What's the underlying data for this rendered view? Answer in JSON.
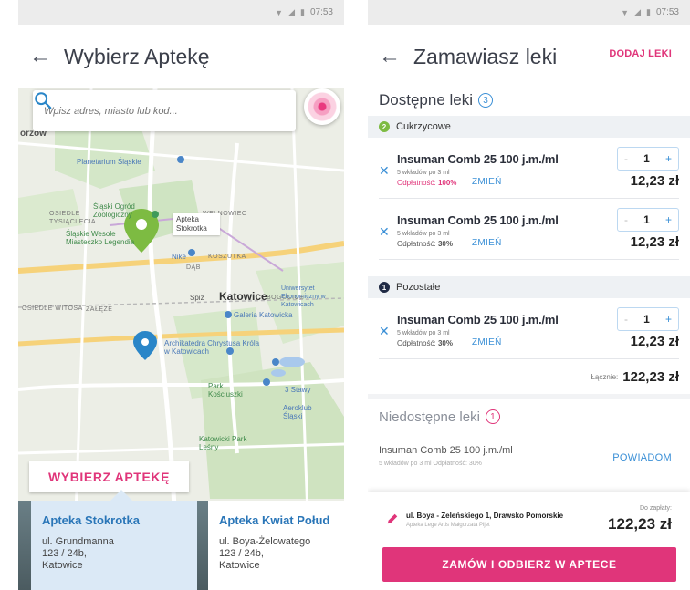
{
  "left": {
    "status": {
      "time": "07:53"
    },
    "title": "Wybierz Aptekę",
    "search": {
      "placeholder": "Wpisz adres, miasto lub kod..."
    },
    "map": {
      "labels": {
        "city": "Katowice",
        "chorzow": "orzów",
        "planetarium": "Planetarium Śląskie",
        "garden": "Śląski Ogród Zoologiczny",
        "osiedle_1000": "OSIEDLE TYSIĄCLECIA",
        "stadium": "Śląskie Wesołe Miasteczko Legendia",
        "welnowiec": "WELNOWIEC",
        "nike": "Nike",
        "koszutka": "KOSZUTKA",
        "dab": "DĄB",
        "bogucice": "BOGUCICE",
        "spiz": "Spiż",
        "witosa": "OSIEDLE WITOSA",
        "zaleze": "ZAŁĘŻE",
        "uni": "Uniwersytet Ekonomiczny w Katowicach",
        "galeria": "Galeria Katowicka",
        "archikatedra": "Archikatedra Chrystusa Króla w Katowicach",
        "park": "Park Kościuszki",
        "stawy": "3 Stawy",
        "aeroklub": "Aeroklub Śląski",
        "forest": "Katowicki Park Leśny"
      },
      "pin_label": "Apteka Stokrotka"
    },
    "choose_button": "WYBIERZ APTEKĘ",
    "cards": [
      {
        "name": "Apteka Stokrotka",
        "addr1": "ul. Grundmanna",
        "addr2": "123 / 24b,",
        "addr3": "Katowice"
      },
      {
        "name": "Apteka Kwiat Połud",
        "addr1": "ul. Boya-Żelowatego",
        "addr2": "123 / 24b,",
        "addr3": "Katowice"
      }
    ]
  },
  "right": {
    "status": {
      "time": "07:53"
    },
    "title": "Zamawiasz leki",
    "add_button": "DODAJ LEKI",
    "available": {
      "title": "Dostępne leki",
      "count": "3"
    },
    "groups": [
      {
        "num": "2",
        "name": "Cukrzycowe",
        "color": "#7dbb42"
      },
      {
        "num": "1",
        "name": "Pozostałe",
        "color": "#1f2a44"
      }
    ],
    "items": [
      {
        "name": "Insuman Comb 25 100 j.m./ml",
        "pack": "5 wkładów po 3 ml",
        "pay_label": "Odpłatność:",
        "pay_value": "100%",
        "change": "ZMIEŃ",
        "qty": "1",
        "minus": "-",
        "plus": "+",
        "price": "12,23 zł"
      },
      {
        "name": "Insuman Comb 25 100 j.m./ml",
        "pack": "5 wkładów po 3 ml",
        "pay_label": "Odpłatność:",
        "pay_value": "30%",
        "change": "ZMIEŃ",
        "qty": "1",
        "minus": "-",
        "plus": "+",
        "price": "12,23 zł"
      },
      {
        "name": "Insuman Comb 25 100 j.m./ml",
        "pack": "5 wkładów po 3 ml",
        "pay_label": "Odpłatność:",
        "pay_value": "30%",
        "change": "ZMIEŃ",
        "qty": "1",
        "minus": "-",
        "plus": "+",
        "price": "12,23 zł"
      }
    ],
    "total": {
      "label": "Łącznie:",
      "value": "122,23 zł"
    },
    "unavailable": {
      "title": "Niedostępne leki",
      "count": "1",
      "name": "Insuman Comb 25 100 j.m./ml",
      "sub": "5 wkładów po 3 ml   Odpłatność: 30%",
      "notify": "POWIADOM"
    },
    "footer": {
      "address": "ul. Boya - Żeleńskiego 1, Drawsko Pomorskie",
      "owner": "Apteka Lege Artis Małgorzata Pijet",
      "due_label": "Do zapłaty:",
      "due": "122,23 zł",
      "order": "ZAMÓW I ODBIERZ W APTECE"
    },
    "close_glyph": "✕"
  },
  "colors": {
    "accent": "#e0357a",
    "link": "#3a8fd6",
    "pin_green": "#7dbb42",
    "pin_blue": "#2a86c8"
  }
}
